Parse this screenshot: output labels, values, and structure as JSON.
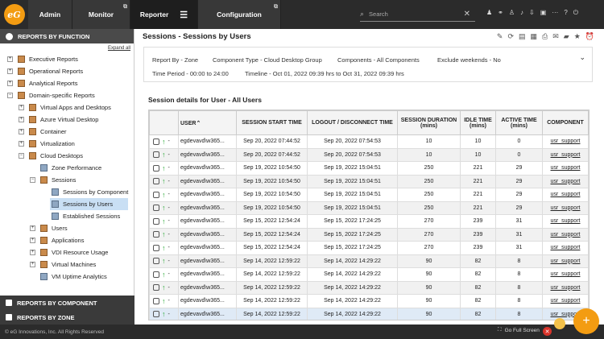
{
  "nav": {
    "admin": "Admin",
    "monitor": "Monitor",
    "reporter": "Reporter",
    "configuration": "Configuration",
    "search_placeholder": "Search"
  },
  "sidebar": {
    "header": "REPORTS BY FUNCTION",
    "expand_all": "Expand all",
    "items": [
      "Executive Reports",
      "Operational Reports",
      "Analytical Reports",
      "Domain-specific Reports",
      "Virtual Apps and Desktops",
      "Azure Virtual Desktop",
      "Container",
      "Virtualization",
      "Cloud Desktops",
      "Zone Performance",
      "Sessions",
      "Sessions by Component",
      "Sessions by Users",
      "Established Sessions",
      "Users",
      "Applications",
      "VDI Resource Usage",
      "Virtual Machines",
      "VM Uptime Analytics"
    ],
    "by_component": "REPORTS BY COMPONENT",
    "by_zone": "REPORTS BY ZONE"
  },
  "main": {
    "title": "Sessions - Sessions by Users",
    "info": {
      "report_by": "Report By - Zone",
      "component_type": "Component Type - Cloud Desktop Group",
      "components": "Components - All Components",
      "exclude": "Exclude weekends - No",
      "time_period": "Time Period - 00:00 to 24:00",
      "timeline": "Timeline - Oct 01, 2022 09:39 hrs to Oct 31, 2022 09:39 hrs"
    },
    "section_title": "Session details for User - All Users",
    "columns": {
      "user": "USER",
      "start": "SESSION START TIME",
      "logout": "LOGOUT / DISCONNECT TIME",
      "duration": "SESSION DURATION",
      "duration_unit": "(mins)",
      "idle": "IDLE TIME",
      "idle_unit": "(mins)",
      "active": "ACTIVE TIME",
      "active_unit": "(mins)",
      "component": "COMPONENT"
    },
    "rows": [
      {
        "dash": "-",
        "user": "egdevavd\\w365...",
        "start": "Sep 20, 2022 07:44:52",
        "logout": "Sep 20, 2022 07:54:53",
        "duration": "10",
        "idle": "10",
        "active": "0",
        "component": "usr_support"
      },
      {
        "dash": "-",
        "user": "egdevavd\\w365...",
        "start": "Sep 20, 2022 07:44:52",
        "logout": "Sep 20, 2022 07:54:53",
        "duration": "10",
        "idle": "10",
        "active": "0",
        "component": "usr_support"
      },
      {
        "dash": "-",
        "user": "egdevavd\\w365...",
        "start": "Sep 19, 2022 10:54:50",
        "logout": "Sep 19, 2022 15:04:51",
        "duration": "250",
        "idle": "221",
        "active": "29",
        "component": "usr_support"
      },
      {
        "dash": "-",
        "user": "egdevavd\\w365...",
        "start": "Sep 19, 2022 10:54:50",
        "logout": "Sep 19, 2022 15:04:51",
        "duration": "250",
        "idle": "221",
        "active": "29",
        "component": "usr_support"
      },
      {
        "dash": "-",
        "user": "egdevavd\\w365...",
        "start": "Sep 19, 2022 10:54:50",
        "logout": "Sep 19, 2022 15:04:51",
        "duration": "250",
        "idle": "221",
        "active": "29",
        "component": "usr_support"
      },
      {
        "dash": "-",
        "user": "egdevavd\\w365...",
        "start": "Sep 19, 2022 10:54:50",
        "logout": "Sep 19, 2022 15:04:51",
        "duration": "250",
        "idle": "221",
        "active": "29",
        "component": "usr_support"
      },
      {
        "dash": "-",
        "user": "egdevavd\\w365...",
        "start": "Sep 15, 2022 12:54:24",
        "logout": "Sep 15, 2022 17:24:25",
        "duration": "270",
        "idle": "239",
        "active": "31",
        "component": "usr_support"
      },
      {
        "dash": "-",
        "user": "egdevavd\\w365...",
        "start": "Sep 15, 2022 12:54:24",
        "logout": "Sep 15, 2022 17:24:25",
        "duration": "270",
        "idle": "239",
        "active": "31",
        "component": "usr_support"
      },
      {
        "dash": "-",
        "user": "egdevavd\\w365...",
        "start": "Sep 15, 2022 12:54:24",
        "logout": "Sep 15, 2022 17:24:25",
        "duration": "270",
        "idle": "239",
        "active": "31",
        "component": "usr_support"
      },
      {
        "dash": "-",
        "user": "egdevavd\\w365...",
        "start": "Sep 14, 2022 12:59:22",
        "logout": "Sep 14, 2022 14:29:22",
        "duration": "90",
        "idle": "82",
        "active": "8",
        "component": "usr_support"
      },
      {
        "dash": "-",
        "user": "egdevavd\\w365...",
        "start": "Sep 14, 2022 12:59:22",
        "logout": "Sep 14, 2022 14:29:22",
        "duration": "90",
        "idle": "82",
        "active": "8",
        "component": "usr_support"
      },
      {
        "dash": "-",
        "user": "egdevavd\\w365...",
        "start": "Sep 14, 2022 12:59:22",
        "logout": "Sep 14, 2022 14:29:22",
        "duration": "90",
        "idle": "82",
        "active": "8",
        "component": "usr_support"
      },
      {
        "dash": "-",
        "user": "egdevavd\\w365...",
        "start": "Sep 14, 2022 12:59:22",
        "logout": "Sep 14, 2022 14:29:22",
        "duration": "90",
        "idle": "82",
        "active": "8",
        "component": "usr_support"
      },
      {
        "dash": "-",
        "user": "egdevavd\\w365...",
        "start": "Sep 14, 2022 12:59:22",
        "logout": "Sep 14, 2022 14:29:22",
        "duration": "90",
        "idle": "82",
        "active": "8",
        "component": "usr_support"
      }
    ]
  },
  "footer": {
    "copyright": "© eG Innovations, Inc. All Rights Reserved",
    "full_screen": "Go Full Screen"
  },
  "colors": {
    "accent": "#f39c12",
    "topbar": "#2b2b2b",
    "selected": "#c9dff4"
  }
}
